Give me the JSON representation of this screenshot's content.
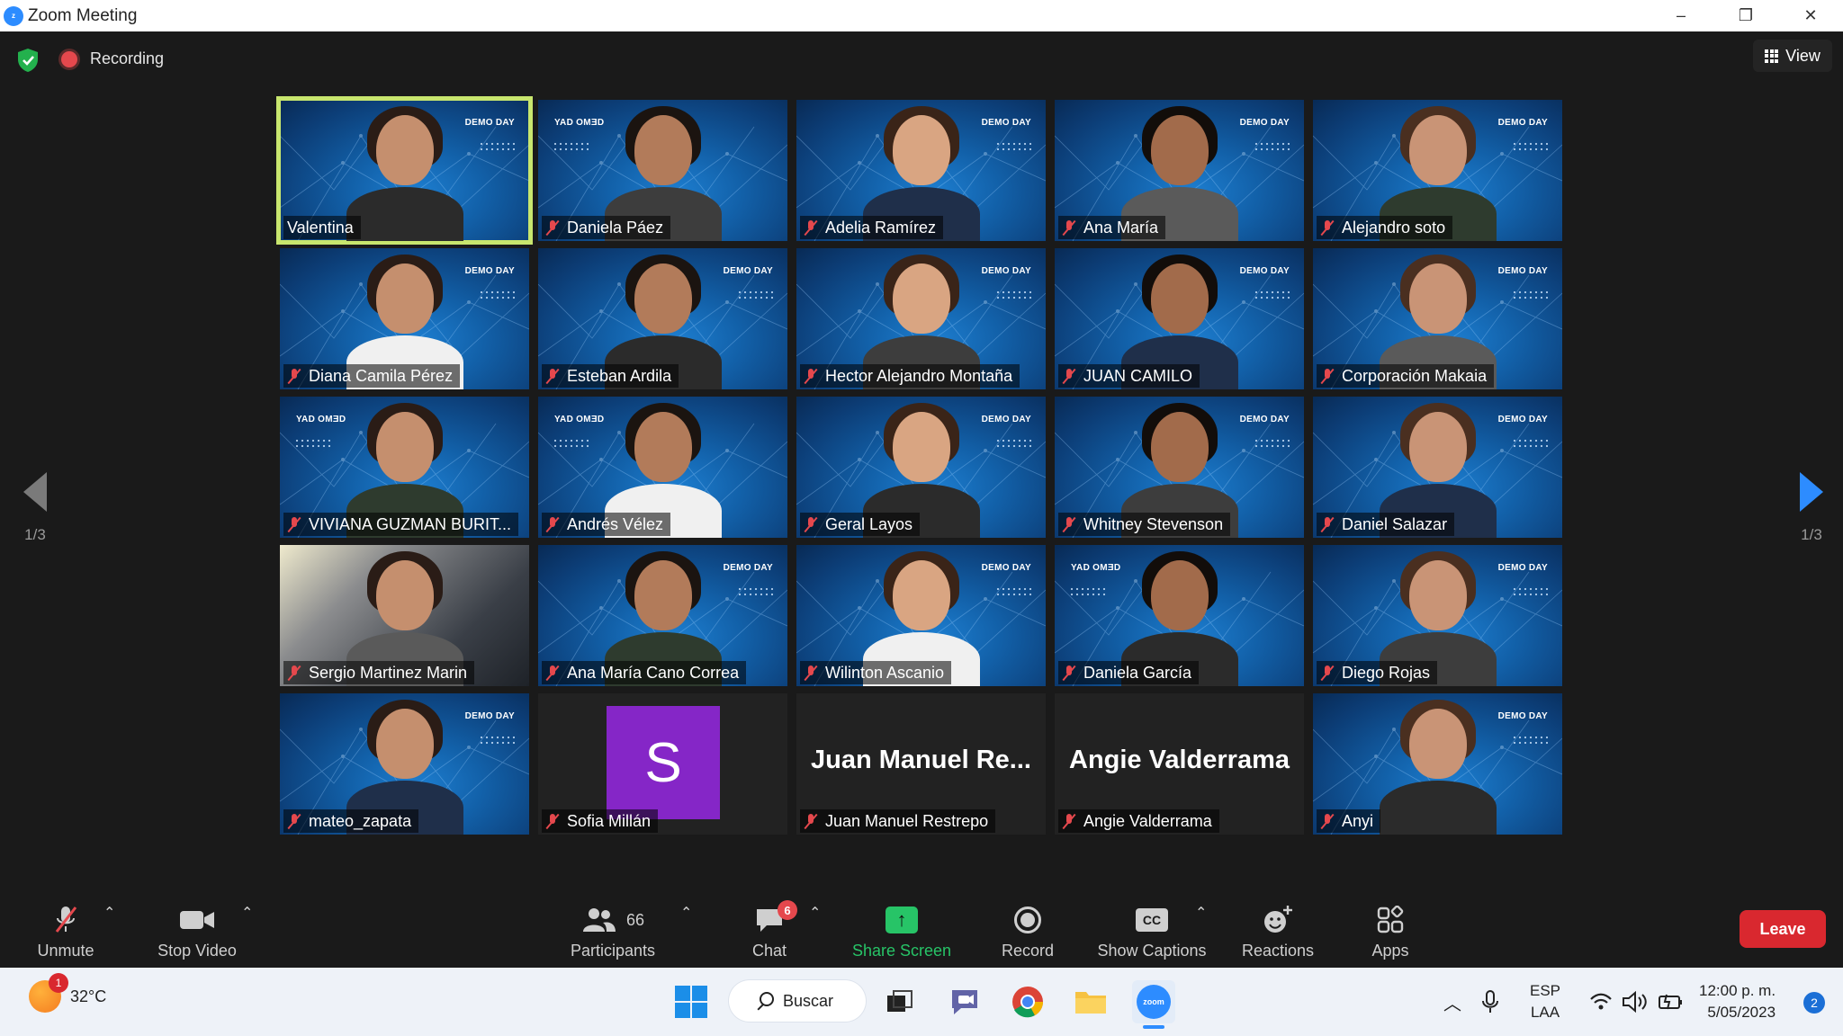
{
  "window": {
    "title": "Zoom Meeting",
    "minimize": "–",
    "restore": "❐",
    "close": "✕"
  },
  "meeting": {
    "recording_label": "Recording",
    "view_label": "View",
    "page_indicator_left": "1/3",
    "page_indicator_right": "1/3"
  },
  "tiles": [
    {
      "name": "Valentina",
      "muted": false,
      "active": true,
      "style": "bg"
    },
    {
      "name": "Daniela Páez",
      "muted": true,
      "style": "bg-mirror"
    },
    {
      "name": "Adelia Ramírez",
      "muted": true,
      "style": "bg"
    },
    {
      "name": "Ana María",
      "muted": true,
      "style": "bg"
    },
    {
      "name": "Alejandro soto",
      "muted": true,
      "style": "bg"
    },
    {
      "name": "Diana Camila Pérez",
      "muted": true,
      "style": "bg"
    },
    {
      "name": "Esteban Ardila",
      "muted": true,
      "style": "bg"
    },
    {
      "name": "Hector Alejandro Montaña",
      "muted": true,
      "style": "bg"
    },
    {
      "name": "JUAN CAMILO",
      "muted": true,
      "style": "bg"
    },
    {
      "name": "Corporación Makaia",
      "muted": true,
      "style": "bg"
    },
    {
      "name": "VIVIANA GUZMAN BURIT...",
      "muted": true,
      "style": "bg-mirror"
    },
    {
      "name": "Andrés Vélez",
      "muted": true,
      "style": "bg-mirror"
    },
    {
      "name": "Geral Layos",
      "muted": true,
      "style": "bg"
    },
    {
      "name": "Whitney Stevenson",
      "muted": true,
      "style": "bg"
    },
    {
      "name": "Daniel Salazar",
      "muted": true,
      "style": "bg"
    },
    {
      "name": "Sergio Martinez Marin",
      "muted": true,
      "style": "photo"
    },
    {
      "name": "Ana María Cano Correa",
      "muted": true,
      "style": "bg"
    },
    {
      "name": "Wilinton Ascanio",
      "muted": true,
      "style": "bg"
    },
    {
      "name": "Daniela García",
      "muted": true,
      "style": "bg-mirror"
    },
    {
      "name": "Diego Rojas",
      "muted": true,
      "style": "bg"
    },
    {
      "name": "mateo_zapata",
      "muted": true,
      "style": "bg"
    },
    {
      "name": "Sofia Millán",
      "muted": true,
      "style": "avatar",
      "avatar_letter": "S",
      "avatar_color": "#8526c7"
    },
    {
      "name": "Juan Manuel Restrepo",
      "muted": true,
      "style": "text",
      "big_name": "Juan Manuel Re..."
    },
    {
      "name": "Angie Valderrama",
      "muted": true,
      "style": "text",
      "big_name": "Angie Valderrama"
    },
    {
      "name": "Anyi",
      "muted": true,
      "style": "bg"
    }
  ],
  "background_text": {
    "bootcamp": "<Bootcamp>",
    "demo_day": "DEMO DAY",
    "demo_day_mirrored": "YAD OMƎD"
  },
  "toolbar": {
    "unmute": "Unmute",
    "stop_video": "Stop Video",
    "participants": "Participants",
    "participants_count": "66",
    "chat": "Chat",
    "chat_badge": "6",
    "share_screen": "Share Screen",
    "record": "Record",
    "show_captions": "Show Captions",
    "captions_icon_text": "CC",
    "reactions": "Reactions",
    "apps": "Apps",
    "leave": "Leave"
  },
  "taskbar": {
    "temperature": "32°C",
    "weather_badge": "1",
    "search_label": "Buscar",
    "zoom_icon_text": "zoom",
    "language_primary": "ESP",
    "language_secondary": "LAA",
    "time": "12:00 p. m.",
    "date": "5/05/2023",
    "notification_count": "2"
  },
  "colors": {
    "accent": "#2d8cff",
    "active_speaker": "#c8e66e",
    "mute_red": "#e5484d",
    "share_green": "#27c467",
    "leave_red": "#d9282f"
  }
}
